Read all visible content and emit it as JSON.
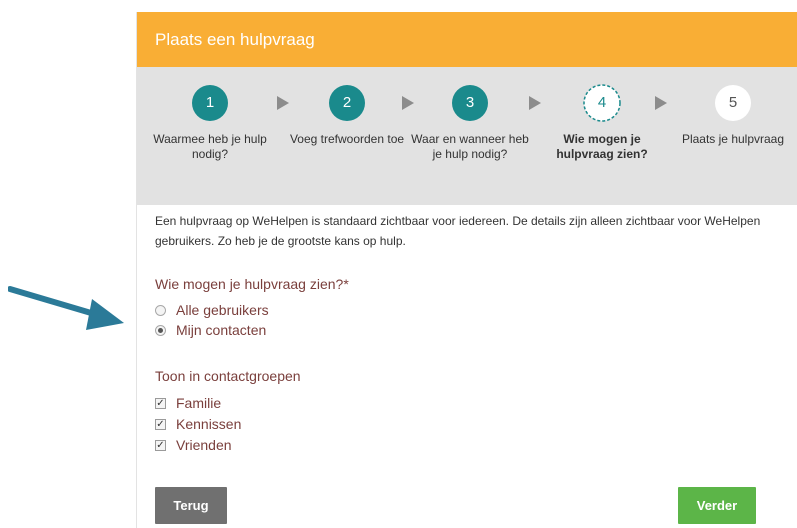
{
  "header": {
    "title": "Plaats een hulpvraag"
  },
  "steps": [
    {
      "number": "1",
      "label": "Waarmee heb je hulp nodig?",
      "state": "done"
    },
    {
      "number": "2",
      "label": "Voeg trefwoorden toe",
      "state": "done"
    },
    {
      "number": "3",
      "label": "Waar en wanneer heb je hulp nodig?",
      "state": "done"
    },
    {
      "number": "4",
      "label": "Wie mogen je hulpvraag zien?",
      "state": "active"
    },
    {
      "number": "5",
      "label": "Plaats je hulpvraag",
      "state": "todo"
    }
  ],
  "intro": "Een hulpvraag op WeHelpen is standaard zichtbaar voor iedereen. De details zijn alleen zichtbaar voor WeHelpen gebruikers. Zo heb je de grootste kans op hulp.",
  "visibility": {
    "question": "Wie mogen je hulpvraag zien?*",
    "options": [
      {
        "label": "Alle gebruikers",
        "checked": false
      },
      {
        "label": "Mijn contacten",
        "checked": true
      }
    ]
  },
  "groups": {
    "title": "Toon in contactgroepen",
    "items": [
      {
        "label": "Familie",
        "checked": true
      },
      {
        "label": "Kennissen",
        "checked": true
      },
      {
        "label": "Vrienden",
        "checked": true
      }
    ]
  },
  "buttons": {
    "back": "Terug",
    "next": "Verder"
  },
  "colors": {
    "header": "#f9ae35",
    "step_done": "#1a8a8c",
    "label_text": "#7a3f3c",
    "back_button": "#707070",
    "next_button": "#5cb548"
  }
}
